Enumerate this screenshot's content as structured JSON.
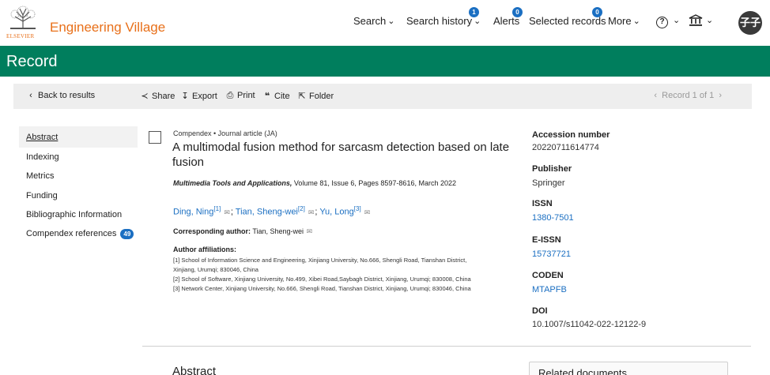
{
  "brand": {
    "name": "Engineering Village",
    "publisher_logo_text": "ELSEVIER"
  },
  "nav": {
    "search": "Search",
    "search_history": "Search history",
    "search_history_badge": "1",
    "alerts": "Alerts",
    "alerts_badge": "0",
    "selected_records": "Selected records",
    "selected_records_badge": "0",
    "more": "More",
    "avatar_initials": "子子"
  },
  "record_bar": {
    "title": "Record"
  },
  "toolbar": {
    "back": "Back to results",
    "share": "Share",
    "export": "Export",
    "print": "Print",
    "cite": "Cite",
    "folder": "Folder",
    "record_position": "Record 1 of 1"
  },
  "sidebar": {
    "items": [
      {
        "label": "Abstract"
      },
      {
        "label": "Indexing"
      },
      {
        "label": "Metrics"
      },
      {
        "label": "Funding"
      },
      {
        "label": "Bibliographic Information"
      },
      {
        "label": "Compendex references",
        "badge": "49"
      }
    ]
  },
  "record": {
    "doc_type": "Compendex • Journal article (JA)",
    "title": "A multimodal fusion method for sarcasm detection based on late fusion",
    "source_journal": "Multimedia Tools and Applications,",
    "source_details": " Volume 81, Issue 6, Pages 8597-8616, March 2022",
    "authors": [
      {
        "name": "Ding, Ning",
        "sup": "[1]"
      },
      {
        "name": "Tian, Sheng-wei",
        "sup": "[2]"
      },
      {
        "name": "Yu, Long",
        "sup": "[3]"
      }
    ],
    "corresponding_label": "Corresponding author:",
    "corresponding_name": " Tian, Sheng-wei",
    "affiliations_label": "Author affiliations:",
    "affiliations": [
      "[1] School of Information Science and Engineering, Xinjiang University, No.666, Shengli Road, Tianshan District,",
      "Xinjiang, Urumqi; 830046, China",
      "[2] School of Software, Xinjiang University, No.499, Xibei Road,Saybagh District, Xinjiang, Urumqi; 830008, China",
      "[3] Network Center, Xinjiang University, No.666, Shengli Road, Tianshan District, Xinjiang, Urumqi; 830046, China"
    ]
  },
  "meta": {
    "accession_label": "Accession number",
    "accession_value": "20220711614774",
    "publisher_label": "Publisher",
    "publisher_value": "Springer",
    "issn_label": "ISSN",
    "issn_value": "1380-7501",
    "eissn_label": "E-ISSN",
    "eissn_value": "15737721",
    "coden_label": "CODEN",
    "coden_value": "MTAPFB",
    "doi_label": "DOI",
    "doi_value": "10.1007/s11042-022-12122-9"
  },
  "abstract_heading": "Abstract",
  "related_heading": "Related documents",
  "colors": {
    "brand_orange": "#e8701a",
    "record_green": "#007e5d",
    "link_blue": "#1b6fc2"
  }
}
